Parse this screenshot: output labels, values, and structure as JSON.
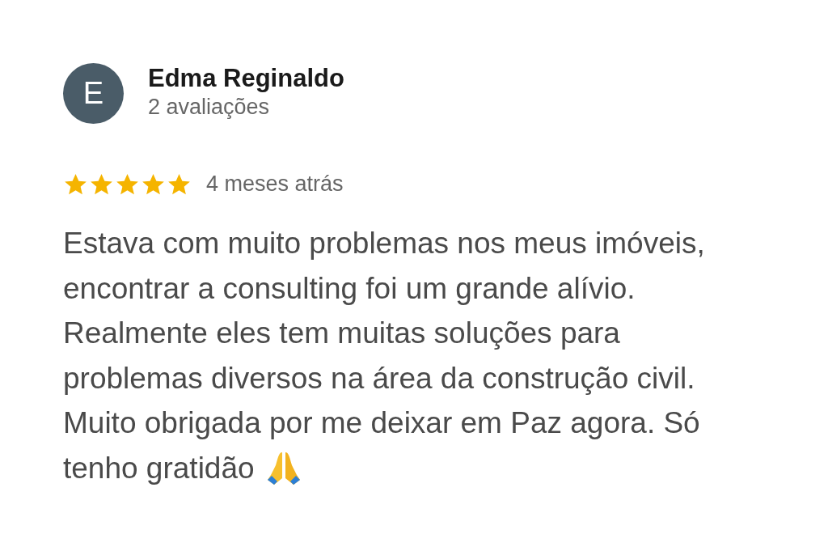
{
  "review": {
    "avatar_letter": "E",
    "author": "Edma Reginaldo",
    "review_count": "2 avaliações",
    "stars": 5,
    "time": "4 meses atrás",
    "text_lines": [
      "Estava com muito problemas nos meus imóveis,",
      "encontrar a consulting foi um grande alívio.",
      "Realmente eles tem muitas soluções para",
      "problemas diversos na área da construção civil.",
      "Muito obrigada por me deixar em Paz agora. Só",
      "tenho gratidão"
    ]
  }
}
